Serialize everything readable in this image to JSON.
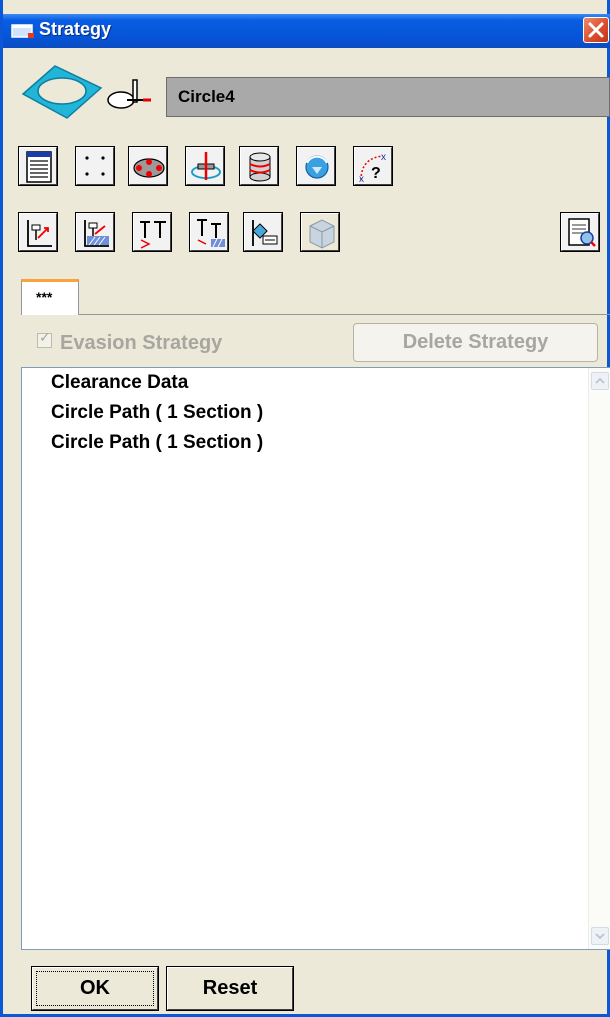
{
  "window": {
    "title": "Strategy",
    "title_icon": "window-app-icon",
    "close_icon": "close-icon"
  },
  "header": {
    "part_icon": "pocket-outline-icon",
    "tool_icon": "tool-holder-icon",
    "operation_name": "Circle4"
  },
  "toolbar_row1": [
    {
      "icon": "parameters-list-icon"
    },
    {
      "icon": "points-pattern-icon"
    },
    {
      "icon": "drill-points-icon"
    },
    {
      "icon": "tool-axis-icon"
    },
    {
      "icon": "stock-cylinder-icon"
    },
    {
      "icon": "rotation-sphere-icon"
    },
    {
      "icon": "unknown-path-icon"
    }
  ],
  "toolbar_row2": [
    {
      "icon": "approach-axes-icon"
    },
    {
      "icon": "approach-hatched-icon"
    },
    {
      "icon": "tool-depth-icon"
    },
    {
      "icon": "tool-depth-hatched-icon"
    },
    {
      "icon": "clamp-offset-icon"
    },
    {
      "icon": "cube-disabled-icon"
    }
  ],
  "preview_icon": "report-preview-icon",
  "tabs": [
    {
      "label": "***"
    }
  ],
  "evasion": {
    "label": "Evasion Strategy",
    "checked": true,
    "enabled": false
  },
  "delete_button": {
    "label": "Delete Strategy",
    "enabled": false
  },
  "list": {
    "items": [
      "Clearance Data",
      "Circle Path  ( 1 Section )",
      "Circle Path  ( 1 Section )"
    ]
  },
  "buttons": {
    "ok": "OK",
    "reset": "Reset"
  },
  "colors": {
    "titlebar": "#0654d8",
    "close": "#d94a2a",
    "tab_accent": "#f9a33a",
    "window_bg": "#ece9d8"
  }
}
